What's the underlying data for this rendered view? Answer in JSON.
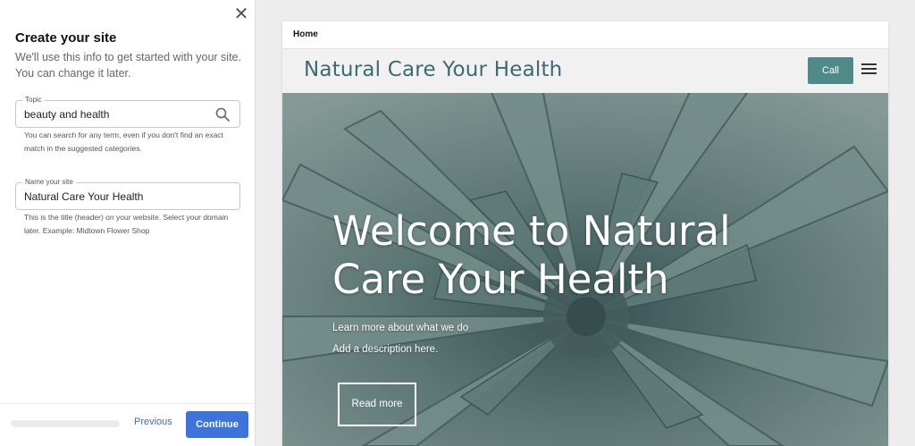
{
  "panel": {
    "title": "Create your site",
    "subtitle": "We'll use this info to get started with your site. You can change it later.",
    "topic": {
      "label": "Topic",
      "value": "beauty and health",
      "help": "You can search for any term, even if you don't find an exact match in the suggested categories."
    },
    "name": {
      "label": "Name your site",
      "value": "Natural Care Your Health",
      "help": "This is the title (header) on your website. Select your domain later. Example: Midtown Flower Shop"
    },
    "previous_label": "Previous",
    "continue_label": "Continue",
    "progress": 0
  },
  "preview": {
    "tab": "Home",
    "site_title": "Natural Care Your Health",
    "call_label": "Call",
    "hero_heading": "Welcome to Natural Care Your Health",
    "hero_line1": "Learn more about what we do",
    "hero_line2": "Add a description here.",
    "read_more_label": "Read more"
  },
  "colors": {
    "accent_blue": "#3d74db",
    "site_teal": "#4d8a88",
    "title_teal": "#3a6b70"
  },
  "icons": [
    "close-icon",
    "search-icon",
    "hamburger-menu-icon"
  ]
}
